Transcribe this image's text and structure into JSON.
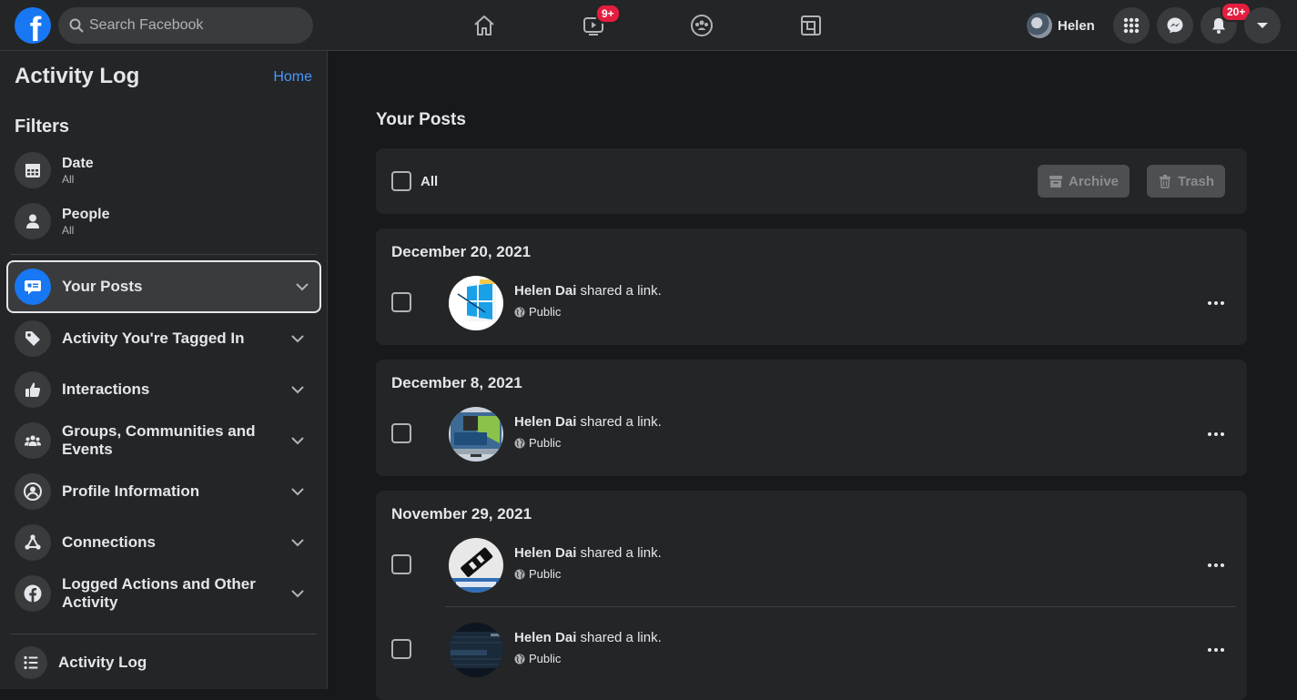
{
  "topbar": {
    "logo_letter": "f",
    "search_placeholder": "Search Facebook",
    "nav": [
      {
        "icon": "home-icon"
      },
      {
        "icon": "watch-icon",
        "badge": "9+"
      },
      {
        "icon": "groups-icon"
      },
      {
        "icon": "gaming-icon"
      }
    ],
    "profile_name": "Helen",
    "notifications_badge": "20+"
  },
  "sidebar": {
    "title": "Activity Log",
    "home_link": "Home",
    "filters_heading": "Filters",
    "filters": [
      {
        "label": "Date",
        "value": "All",
        "icon": "calendar-icon"
      },
      {
        "label": "People",
        "value": "All",
        "icon": "person-icon"
      }
    ],
    "categories": [
      {
        "label": "Your Posts",
        "icon": "posts-icon",
        "active": true
      },
      {
        "label": "Activity You're Tagged In",
        "icon": "tag-icon"
      },
      {
        "label": "Interactions",
        "icon": "thumbs-up-icon"
      },
      {
        "label": "Groups, Communities and Events",
        "icon": "groups-icon"
      },
      {
        "label": "Profile Information",
        "icon": "profile-icon"
      },
      {
        "label": "Connections",
        "icon": "connections-icon"
      },
      {
        "label": "Logged Actions and Other Activity",
        "icon": "facebook-icon"
      }
    ],
    "footer_label": "Activity Log"
  },
  "main": {
    "title": "Your Posts",
    "select_all_label": "All",
    "archive_label": "Archive",
    "trash_label": "Trash",
    "groups": [
      {
        "date": "December 20, 2021",
        "entries": [
          {
            "name": "Helen Dai",
            "action": " shared a link.",
            "privacy": "Public"
          }
        ]
      },
      {
        "date": "December 8, 2021",
        "entries": [
          {
            "name": "Helen Dai",
            "action": " shared a link.",
            "privacy": "Public"
          }
        ]
      },
      {
        "date": "November 29, 2021",
        "entries": [
          {
            "name": "Helen Dai",
            "action": " shared a link.",
            "privacy": "Public"
          },
          {
            "name": "Helen Dai",
            "action": " shared a link.",
            "privacy": "Public"
          }
        ]
      }
    ]
  },
  "colors": {
    "accent": "#1877f2",
    "link": "#4599ff",
    "badge": "#e41e3f",
    "surface": "#242526",
    "background": "#18191a"
  }
}
